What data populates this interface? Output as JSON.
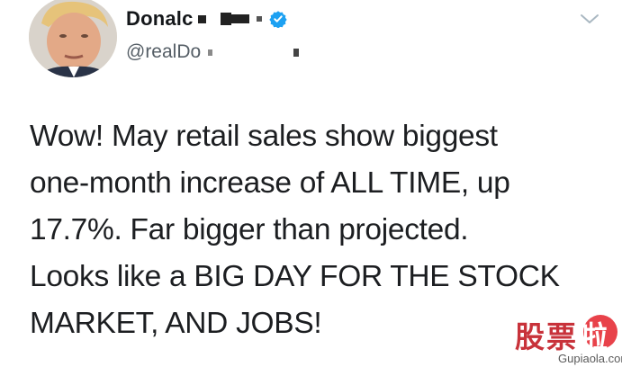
{
  "author": {
    "display_name": "Donalc",
    "handle": "@realDo",
    "avatar_icon": "profile-photo",
    "verified_icon": "verified-badge-icon",
    "verified_color": "#1da1f2"
  },
  "menu": {
    "icon": "chevron-down-icon",
    "color": "#aab8c2"
  },
  "tweet": {
    "lines": [
      "Wow! May retail sales show biggest",
      "one-month increase of ALL TIME, up",
      "17.7%. Far bigger than projected.",
      "Looks like a BIG DAY FOR THE STOCK",
      "MARKET, AND JOBS!"
    ]
  },
  "watermark": {
    "brand_chars": "股票",
    "badge_char": "啦",
    "url": "Gupiaola.com",
    "color": "#c8323a"
  }
}
